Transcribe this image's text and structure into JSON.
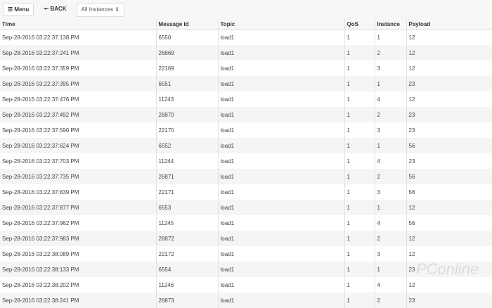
{
  "toolbar": {
    "menu_label": "☰ Menu",
    "back_label": "🠔 BACK",
    "instance_select": "All Instances ⇕"
  },
  "table": {
    "headers": [
      "Time",
      "Message Id",
      "Topic",
      "QoS",
      "Instance",
      "Payload"
    ],
    "rows": [
      [
        "Sep-28-2016 03:22:37:138 PM",
        "6550",
        "load1",
        "1",
        "1",
        "12"
      ],
      [
        "Sep-28-2016 03:22:37:241 PM",
        "26869",
        "load1",
        "1",
        "2",
        "12"
      ],
      [
        "Sep-28-2016 03:22:37:359 PM",
        "22169",
        "load1",
        "1",
        "3",
        "12"
      ],
      [
        "Sep-28-2016 03:22:37:395 PM",
        "6551",
        "load1",
        "1",
        "1",
        "23"
      ],
      [
        "Sep-28-2016 03:22:37:476 PM",
        "11243",
        "load1",
        "1",
        "4",
        "12"
      ],
      [
        "Sep-28-2016 03:22:37:492 PM",
        "26870",
        "load1",
        "1",
        "2",
        "23"
      ],
      [
        "Sep-28-2016 03:22:37:590 PM",
        "22170",
        "load1",
        "1",
        "3",
        "23"
      ],
      [
        "Sep-28-2016 03:22:37:624 PM",
        "6552",
        "load1",
        "1",
        "1",
        "56"
      ],
      [
        "Sep-28-2016 03:22:37:703 PM",
        "11244",
        "load1",
        "1",
        "4",
        "23"
      ],
      [
        "Sep-28-2016 03:22:37:735 PM",
        "26871",
        "load1",
        "1",
        "2",
        "56"
      ],
      [
        "Sep-28-2016 03:22:37:839 PM",
        "22171",
        "load1",
        "1",
        "3",
        "56"
      ],
      [
        "Sep-28-2016 03:22:37:877 PM",
        "6553",
        "load1",
        "1",
        "1",
        "12"
      ],
      [
        "Sep-28-2016 03:22:37:962 PM",
        "11245",
        "load1",
        "1",
        "4",
        "56"
      ],
      [
        "Sep-28-2016 03:22:37:983 PM",
        "26872",
        "load1",
        "1",
        "2",
        "12"
      ],
      [
        "Sep-28-2016 03:22:38:089 PM",
        "22172",
        "load1",
        "1",
        "3",
        "12"
      ],
      [
        "Sep-28-2016 03:22:38:133 PM",
        "6554",
        "load1",
        "1",
        "1",
        "23"
      ],
      [
        "Sep-28-2016 03:22:38:202 PM",
        "11246",
        "load1",
        "1",
        "4",
        "12"
      ],
      [
        "Sep-28-2016 03:22:38:241 PM",
        "26873",
        "load1",
        "1",
        "2",
        "23"
      ]
    ]
  },
  "watermark": "PConline"
}
